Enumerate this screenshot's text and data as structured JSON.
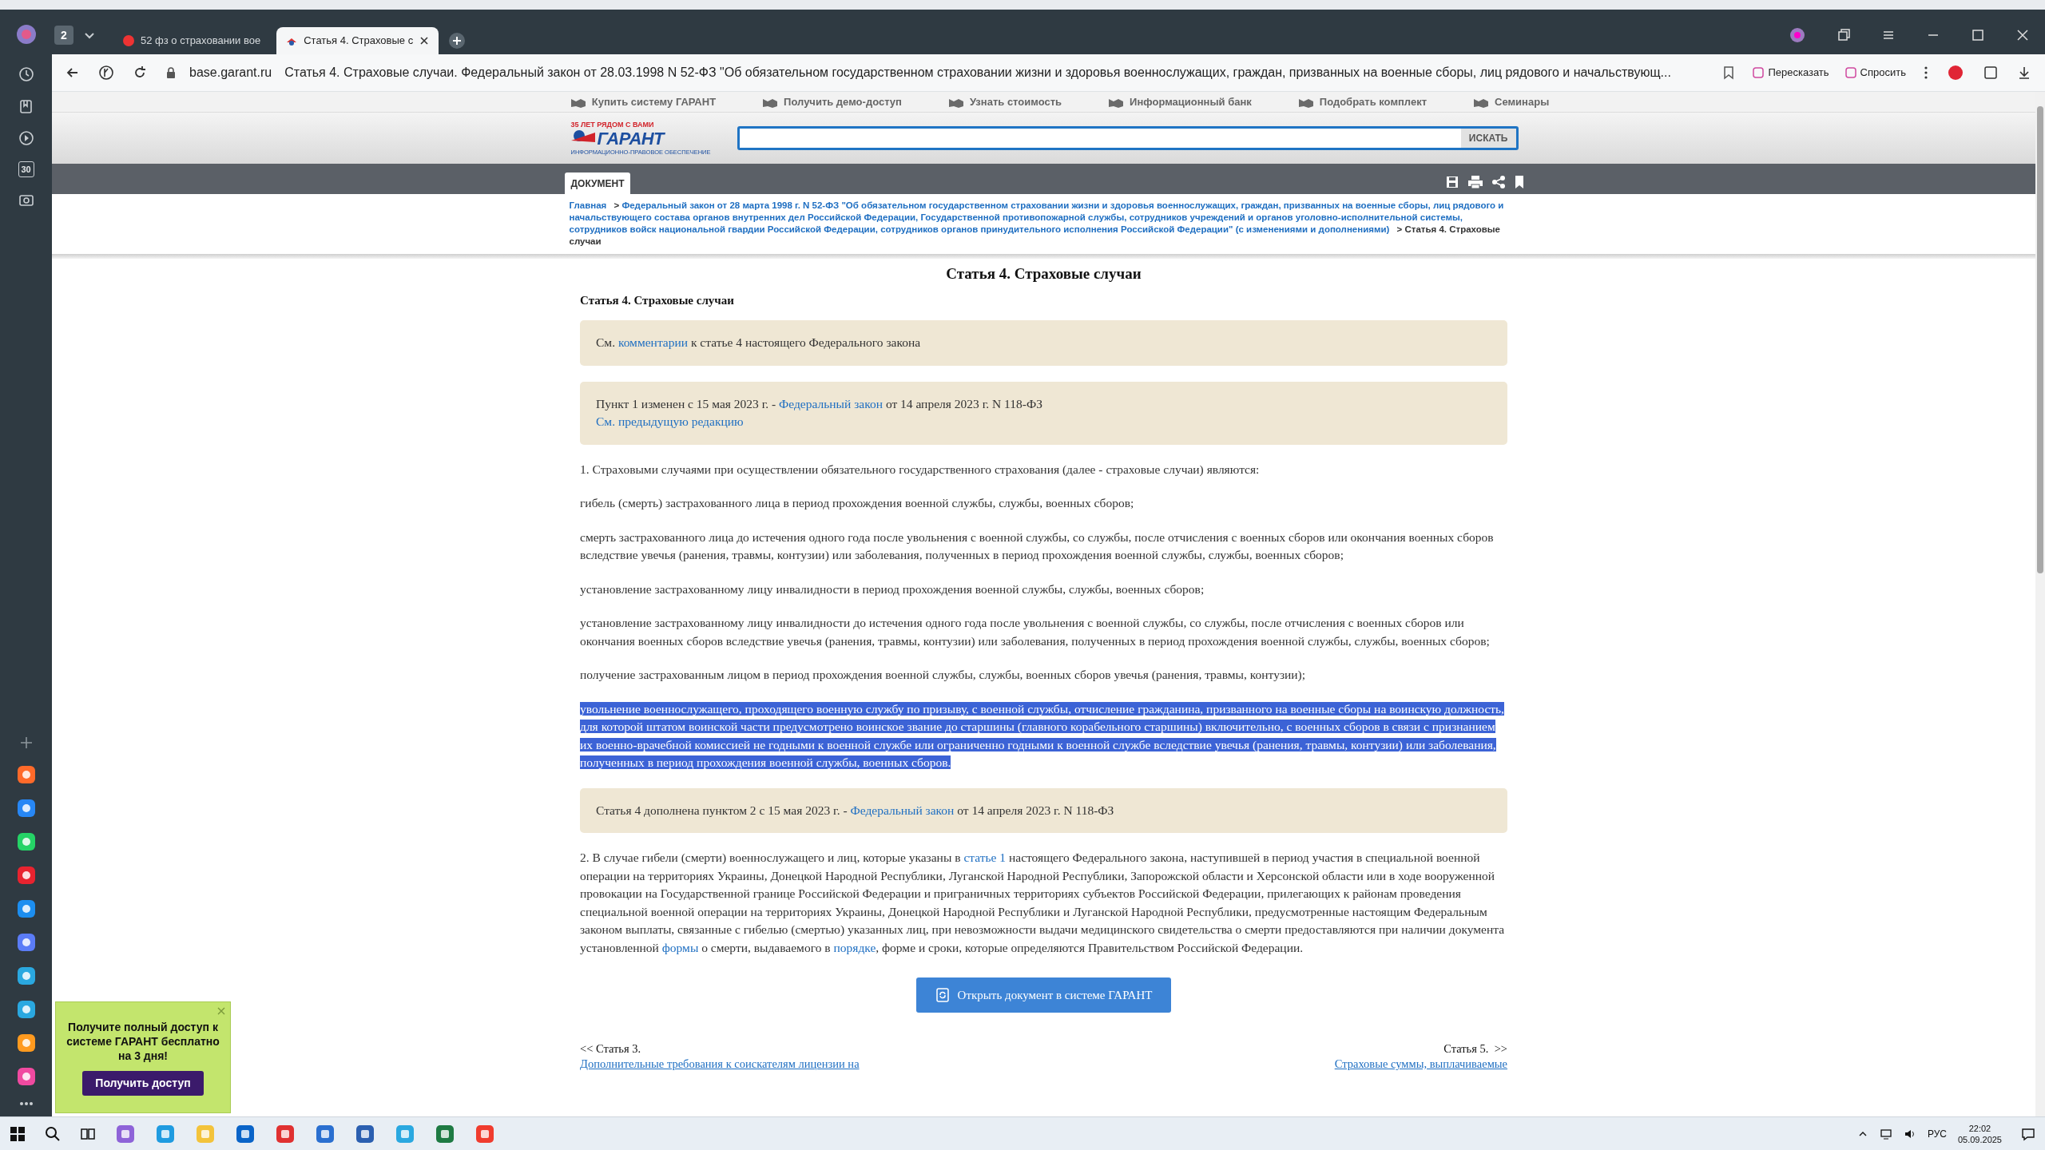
{
  "browser": {
    "tab_count": "2",
    "tabs": [
      {
        "title": "52 фз о страховании вое",
        "selected": false
      },
      {
        "title": "Статья 4. Страховые с",
        "selected": true
      }
    ],
    "address": {
      "domain": "base.garant.ru",
      "title": "Статья 4. Страховые случаи. Федеральный закон от 28.03.1998 N 52-ФЗ \"Об обязательном государственном страховании жизни и здоровья военнослужащих, граждан, призванных на военные сборы, лиц рядового и начальствующ..."
    },
    "actions": [
      "Пересказать",
      "Спросить"
    ],
    "sidebar_calendar": "30"
  },
  "site_nav": [
    "Купить систему ГАРАНТ",
    "Получить демо-доступ",
    "Узнать стоимость",
    "Информационный банк",
    "Подобрать комплект",
    "Семинары"
  ],
  "logo": {
    "tagline": "35 ЛЕТ РЯДОМ С ВАМИ",
    "name": "ГАРАНТ",
    "subtitle": "ИНФОРМАЦИОННО-ПРАВОВОЕ ОБЕСПЕЧЕНИЕ"
  },
  "search": {
    "button": "ИСКАТЬ"
  },
  "doc_tab": "ДОКУМЕНТ",
  "breadcrumb": [
    {
      "kind": "link",
      "text": "Главная"
    },
    {
      "kind": "link",
      "prefix": ">",
      "text": "Федеральный закон от 28 марта 1998 г. N 52-ФЗ \"Об обязательном государственном страховании жизни и здоровья военнослужащих, граждан, призванных на военные сборы, лиц рядового и начальствующего состава органов внутренних дел Российской Федерации, Государственной противопожарной службы, сотрудников учреждений и органов уголовно-исполнительной системы, сотрудников войск национальной гвардии Российской Федерации, сотрудников органов принудительного исполнения Российской Федерации\" (с изменениями и дополнениями)"
    },
    {
      "kind": "current",
      "prefix": ">",
      "text": "Статья 4. Страховые случаи"
    }
  ],
  "page_title": "Статья 4. Страховые случаи",
  "article_heading": "Статья 4. Страховые случаи",
  "blocks": [
    {
      "kind": "note",
      "lines": [
        [
          {
            "text": "См. "
          },
          {
            "text": "комментарии",
            "link": true
          },
          {
            "text": " к статье 4 настоящего Федерального закона"
          }
        ]
      ]
    },
    {
      "kind": "note",
      "lines": [
        [
          {
            "text": "Пункт 1 изменен с 15 мая 2023 г. - "
          },
          {
            "text": "Федеральный закон",
            "link": true
          },
          {
            "text": " от 14 апреля 2023 г. N 118-ФЗ"
          }
        ],
        [
          {
            "text": "См. предыдущую редакцию",
            "link": true
          }
        ]
      ]
    },
    {
      "kind": "para",
      "selected": false,
      "parts": [
        {
          "text": "1. Страховыми случаями при осуществлении обязательного государственного страхования (далее - страховые случаи) являются:"
        }
      ]
    },
    {
      "kind": "para",
      "selected": false,
      "parts": [
        {
          "text": "гибель (смерть) застрахованного лица в период прохождения военной службы, службы, военных сборов;"
        }
      ]
    },
    {
      "kind": "para",
      "selected": false,
      "parts": [
        {
          "text": "смерть застрахованного лица до истечения одного года после увольнения с военной службы, со службы, после отчисления с военных сборов или окончания военных сборов вследствие увечья (ранения, травмы, контузии) или заболевания, полученных в период прохождения военной службы, службы, военных сборов;"
        }
      ]
    },
    {
      "kind": "para",
      "selected": false,
      "parts": [
        {
          "text": "установление застрахованному лицу инвалидности в период прохождения военной службы, службы, военных сборов;"
        }
      ]
    },
    {
      "kind": "para",
      "selected": false,
      "parts": [
        {
          "text": "установление застрахованному лицу инвалидности до истечения одного года после увольнения с военной службы, со службы, после отчисления с военных сборов или окончания военных сборов вследствие увечья (ранения, травмы, контузии) или заболевания, полученных в период прохождения военной службы, службы, военных сборов;"
        }
      ]
    },
    {
      "kind": "para",
      "selected": false,
      "parts": [
        {
          "text": "получение застрахованным лицом в период прохождения военной службы, службы, военных сборов увечья (ранения, травмы, контузии);"
        }
      ]
    },
    {
      "kind": "para",
      "selected": true,
      "parts": [
        {
          "text": "увольнение военнослужащего, проходящего военную службу по призыву, с военной службы, отчисление гражданина, призванного на военные сборы на воинскую должность, для которой штатом воинской части предусмотрено воинское звание до старшины (главного корабельного старшины) включительно, с военных сборов в связи с признанием их военно-врачебной комиссией не годными к военной службе или ограниченно годными к военной службе вследствие увечья (ранения, травмы, контузии) или заболевания, полученных в период прохождения военной службы, военных сборов."
        }
      ]
    },
    {
      "kind": "note",
      "lines": [
        [
          {
            "text": "Статья 4 дополнена пунктом 2 с 15 мая 2023 г. - "
          },
          {
            "text": "Федеральный закон",
            "link": true
          },
          {
            "text": " от 14 апреля 2023 г. N 118-ФЗ"
          }
        ]
      ]
    },
    {
      "kind": "para",
      "selected": false,
      "parts": [
        {
          "text": "2. В случае гибели (смерти) военнослужащего и лиц, которые указаны в "
        },
        {
          "text": "статье 1",
          "link": true
        },
        {
          "text": " настоящего Федерального закона, наступившей в период участия в специальной военной операции на территориях Украины, Донецкой Народной Республики, Луганской Народной Республики, Запорожской области и Херсонской области или в ходе вооруженной провокации на Государственной границе Российской Федерации и приграничных территориях субъектов Российской Федерации, прилегающих к районам проведения специальной военной операции на территориях Украины, Донецкой Народной Республики и Луганской Народной Республики, предусмотренные настоящим Федеральным законом выплаты, связанные с гибелью (смертью) указанных лиц, при невозможности выдачи медицинского свидетельства о смерти предоставляются при наличии документа установленной "
        },
        {
          "text": "формы",
          "link": true
        },
        {
          "text": " о смерти, выдаваемого в "
        },
        {
          "text": "порядке",
          "link": true
        },
        {
          "text": ", форме и сроки, которые определяются Правительством Российской Федерации."
        }
      ]
    }
  ],
  "open_button": "Открыть документ в системе ГАРАНТ",
  "pager": {
    "prev": {
      "label": "<< Статья 3.",
      "link": "Дополнительные требования к соискателям лицензии на"
    },
    "next": {
      "label": "Статья 5.  >>",
      "link": "Страховые суммы, выплачиваемые"
    }
  },
  "promo": {
    "text": "Получите полный доступ к системе ГАРАНТ бесплатно на 3 дня!",
    "button": "Получить доступ"
  },
  "taskbar": {
    "language": "РУС",
    "time": "22:02",
    "date": "05.09.2025"
  }
}
